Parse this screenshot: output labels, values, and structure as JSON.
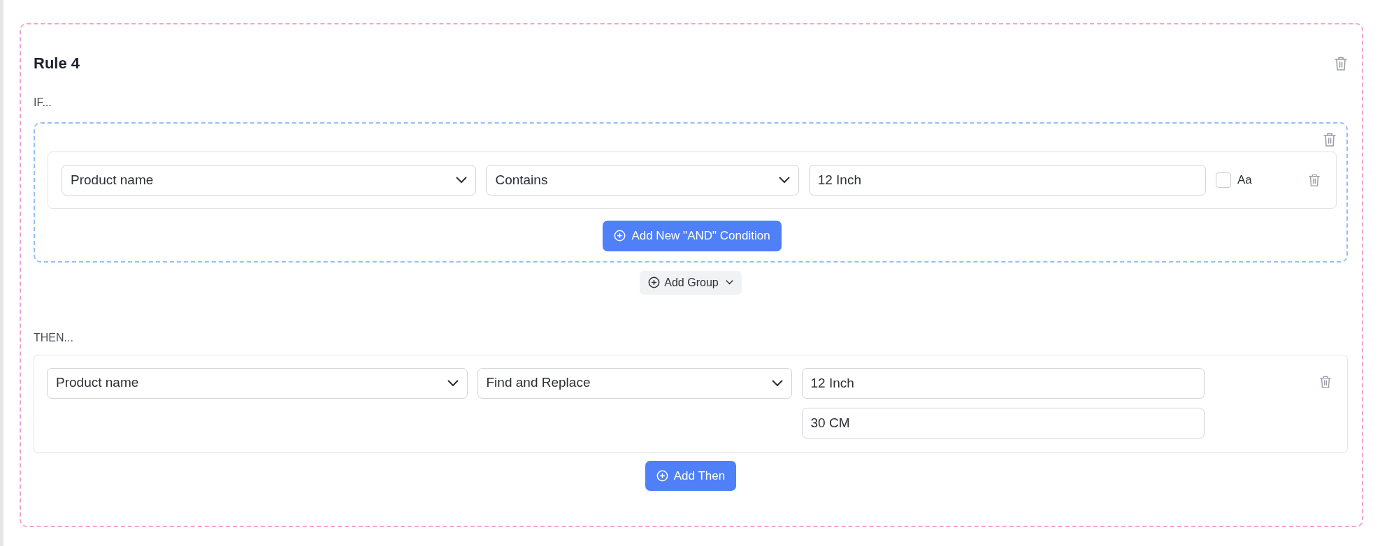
{
  "rule": {
    "title": "Rule 4",
    "if_label": "IF...",
    "groups": [
      {
        "conditions": [
          {
            "field": "Product name",
            "operator": "Contains",
            "value": "12 Inch",
            "case_sensitive": false,
            "case_label": "Aa"
          }
        ],
        "add_button": "Add New \"AND\" Condition"
      }
    ],
    "add_group": "Add Group",
    "then_label": "THEN...",
    "actions": [
      {
        "field": "Product name",
        "action": "Find and Replace",
        "find": "12 Inch",
        "replace": "30 CM"
      }
    ],
    "add_then": "Add Then"
  }
}
